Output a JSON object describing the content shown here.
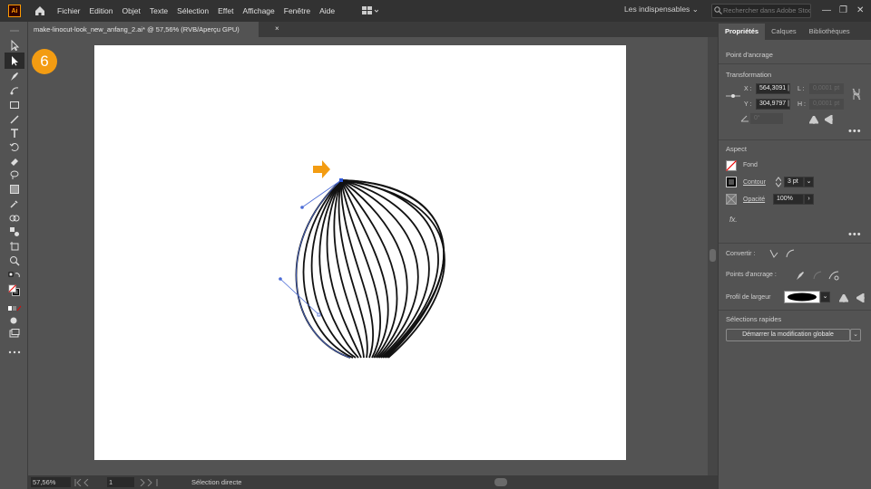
{
  "app": {
    "logo_text": "Ai",
    "menu": [
      "Fichier",
      "Edition",
      "Objet",
      "Texte",
      "Sélection",
      "Effet",
      "Affichage",
      "Fenêtre",
      "Aide"
    ],
    "workspace": "Les indispensables",
    "search_placeholder": "Rechercher dans Adobe Stock",
    "window_controls": [
      "—",
      "❐",
      "✕"
    ]
  },
  "document": {
    "tab_title": "make-linocut-look_new_anfang_2.ai* @ 57,56% (RVB/Aperçu GPU)",
    "close_glyph": "×",
    "step_badge": "6"
  },
  "status": {
    "zoom": "57,56%",
    "page": "1",
    "tool": "Sélection directe"
  },
  "panel": {
    "tabs": [
      "Propriétés",
      "Calques",
      "Bibliothèques"
    ],
    "selection_type": "Point d'ancrage",
    "transform": {
      "title": "Transformation",
      "x_label": "X :",
      "x_value": "564,3091 |",
      "y_label": "Y :",
      "y_value": "304,9797 |",
      "l_label": "L :",
      "l_value": "0,0001 pt",
      "h_label": "H :",
      "h_value": "0,0001 pt",
      "angle_value": "0°"
    },
    "appearance": {
      "title": "Aspect",
      "fill_label": "Fond",
      "stroke_label": "Contour",
      "stroke_value": "3 pt",
      "opacity_label": "Opacité",
      "opacity_value": "100%",
      "fx_label": "fx."
    },
    "convert_label": "Convertir :",
    "anchor_points_label": "Points d'ancrage :",
    "width_profile_label": "Profil de largeur",
    "quick_actions": {
      "title": "Sélections rapides",
      "button": "Démarrer la modification globale"
    },
    "more_glyph": "•••"
  },
  "colors": {
    "accent_orange": "#f39c12",
    "path_blue": "#4a6bd6"
  }
}
